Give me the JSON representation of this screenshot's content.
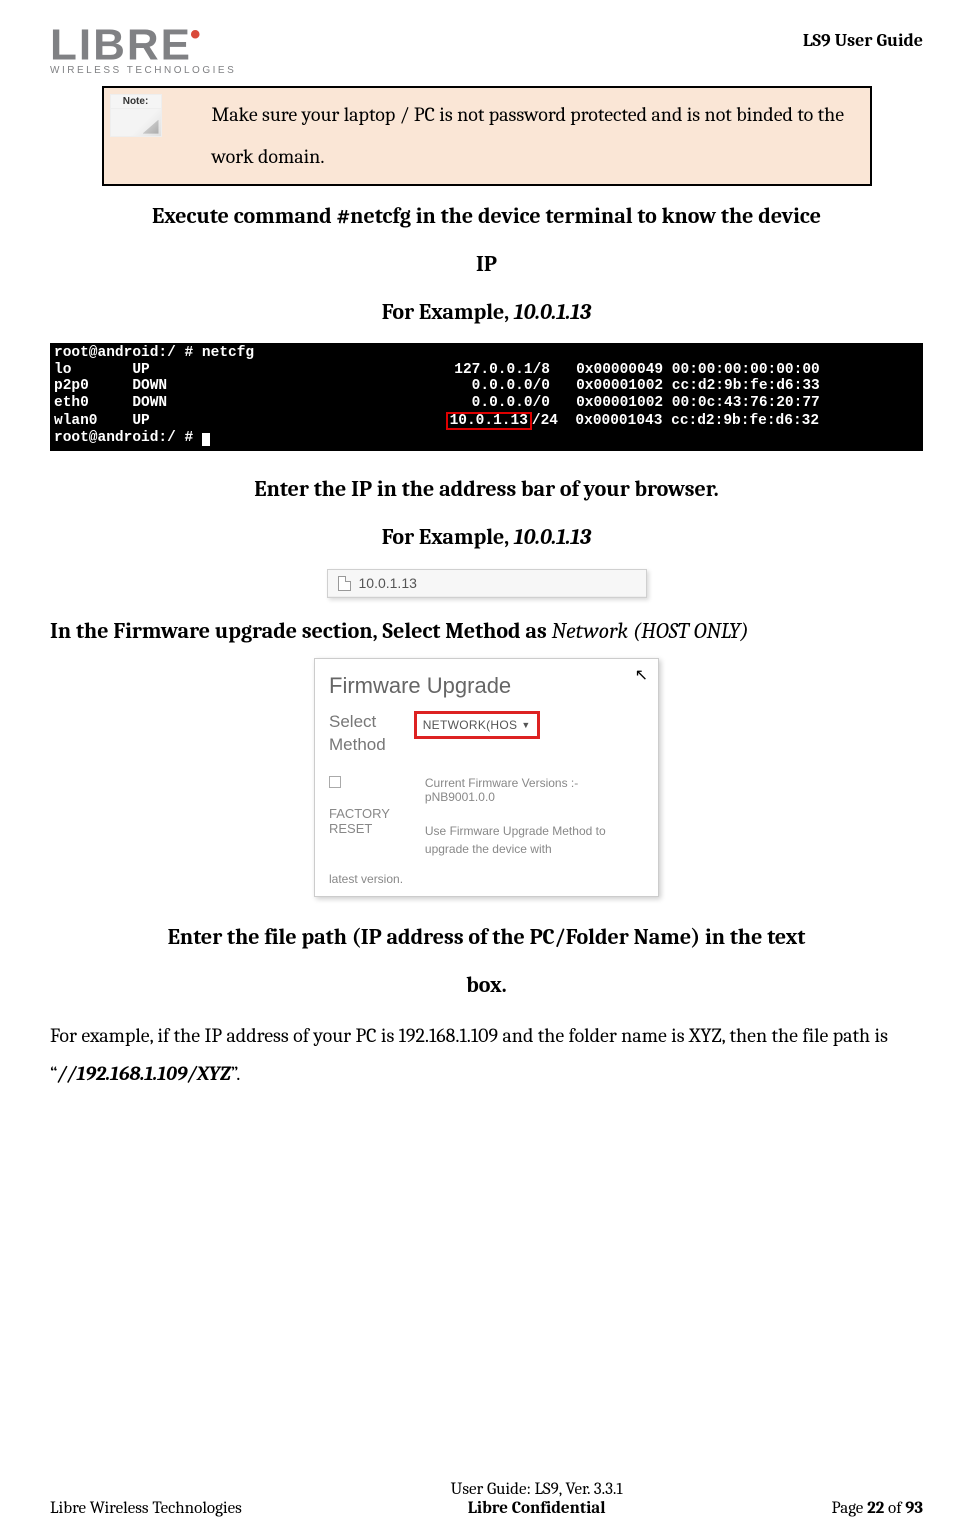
{
  "header": {
    "logo_main": "LIBRE",
    "logo_sub": "WIRELESS TECHNOLOGIES",
    "doc_title": "LS9 User Guide"
  },
  "note": {
    "badge": "Note:",
    "text": "Make sure your laptop / PC is not password protected and is not binded to the work domain."
  },
  "step1": {
    "line1": "Execute command #netcfg in the device terminal to know the device",
    "line2": "IP",
    "line3a": "For Example, ",
    "line3b": "10.0.1.13"
  },
  "terminal": {
    "l1": "root@android:/ # netcfg",
    "l2": "lo       UP                                   127.0.0.1/8   0x00000049 00:00:00:00:00:00",
    "l3": "p2p0     DOWN                                   0.0.0.0/0   0x00001002 cc:d2:9b:fe:d6:33",
    "l4": "eth0     DOWN                                   0.0.0.0/0   0x00001002 00:0c:43:76:20:77",
    "l5a": "wlan0    UP                                  ",
    "l5_hl": "10.0.1.13",
    "l5b": "/24  0x00001043 cc:d2:9b:fe:d6:32",
    "l6": "root@android:/ # "
  },
  "step2": {
    "line1": "Enter the IP in the address bar of your browser.",
    "line2a": "For Example, ",
    "line2b": "10.0.1.13"
  },
  "browser_tab": "10.0.1.13",
  "step3": {
    "a": "In the Firmware upgrade section, Select Method as ",
    "b": "Network (HOST ONLY)"
  },
  "fw_panel": {
    "title": "Firmware Upgrade",
    "select_label": "Select Method",
    "select_value": "NETWORK(HOS",
    "factory_reset": "FACTORY RESET",
    "current_line1": "Current Firmware Versions :-",
    "current_line2": "pNB9001.0.0",
    "msg": "Use Firmware Upgrade Method to upgrade the device with",
    "latest": "latest version."
  },
  "step4": {
    "line1": "Enter the file path (IP address of the PC/Folder Name) in the text",
    "line2": "box."
  },
  "body": {
    "a": "For example, if the IP address of your PC is 192.168.1.109 and the folder name is XYZ, then the file path is “",
    "b": "//192.168.1.109/XYZ",
    "c": "”."
  },
  "footer": {
    "left": "Libre Wireless Technologies",
    "center": "User Guide: LS9, Ver. 3.3.1",
    "confidential": "Libre Confidential",
    "page_a": "Page ",
    "page_b": "22",
    "page_c": " of ",
    "page_d": "93"
  }
}
